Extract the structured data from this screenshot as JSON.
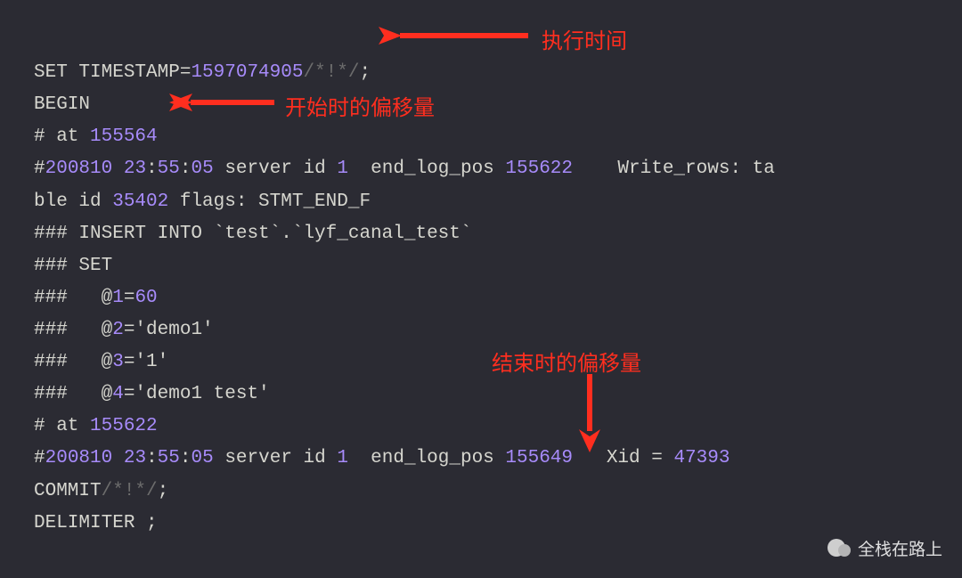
{
  "annotations": {
    "exec_time": "执行时间",
    "start_offset": "开始时的偏移量",
    "end_offset": "结束时的偏移量"
  },
  "code": {
    "l1_a": "SET TIMESTAMP=",
    "l1_ts": "1597074905",
    "l1_cmt": "/*!*/",
    "l1_semi": ";",
    "l2": "BEGIN",
    "l3_a": "# at ",
    "l3_n": "155564",
    "l4_a": "#",
    "l4_date": "200810",
    "l4_sp1": " ",
    "l4_h": "23",
    "l4_c1": ":",
    "l4_m": "55",
    "l4_c2": ":",
    "l4_s": "05",
    "l4_mid": " server id ",
    "l4_sid": "1",
    "l4_mid2": "  end_log_pos ",
    "l4_elp": "155622",
    "l4_tail": "    Write_rows: ta",
    "l5_a": "ble id ",
    "l5_n": "35402",
    "l5_tail": " flags: STMT_END_F",
    "l6": "### INSERT INTO `test`.`lyf_canal_test`",
    "l7": "### SET",
    "l8_a": "###   @",
    "l8_n": "1",
    "l8_eq": "=",
    "l8_v": "60",
    "l9_a": "###   @",
    "l9_n": "2",
    "l9_tail": "='demo1'",
    "l10_a": "###   @",
    "l10_n": "3",
    "l10_tail": "='1'",
    "l11_a": "###   @",
    "l11_n": "4",
    "l11_tail": "='demo1 test'",
    "l12_a": "# at ",
    "l12_n": "155622",
    "l13_a": "#",
    "l13_date": "200810",
    "l13_sp1": " ",
    "l13_h": "23",
    "l13_c1": ":",
    "l13_m": "55",
    "l13_c2": ":",
    "l13_s": "05",
    "l13_mid": " server id ",
    "l13_sid": "1",
    "l13_mid2": "  end_log_pos ",
    "l13_elp": "155649",
    "l13_tail": "   Xid = ",
    "l13_xid": "47393",
    "l14_a": "COMMIT",
    "l14_cmt": "/*!*/",
    "l14_semi": ";",
    "l15": "DELIMITER ;"
  },
  "watermark": "全栈在路上"
}
